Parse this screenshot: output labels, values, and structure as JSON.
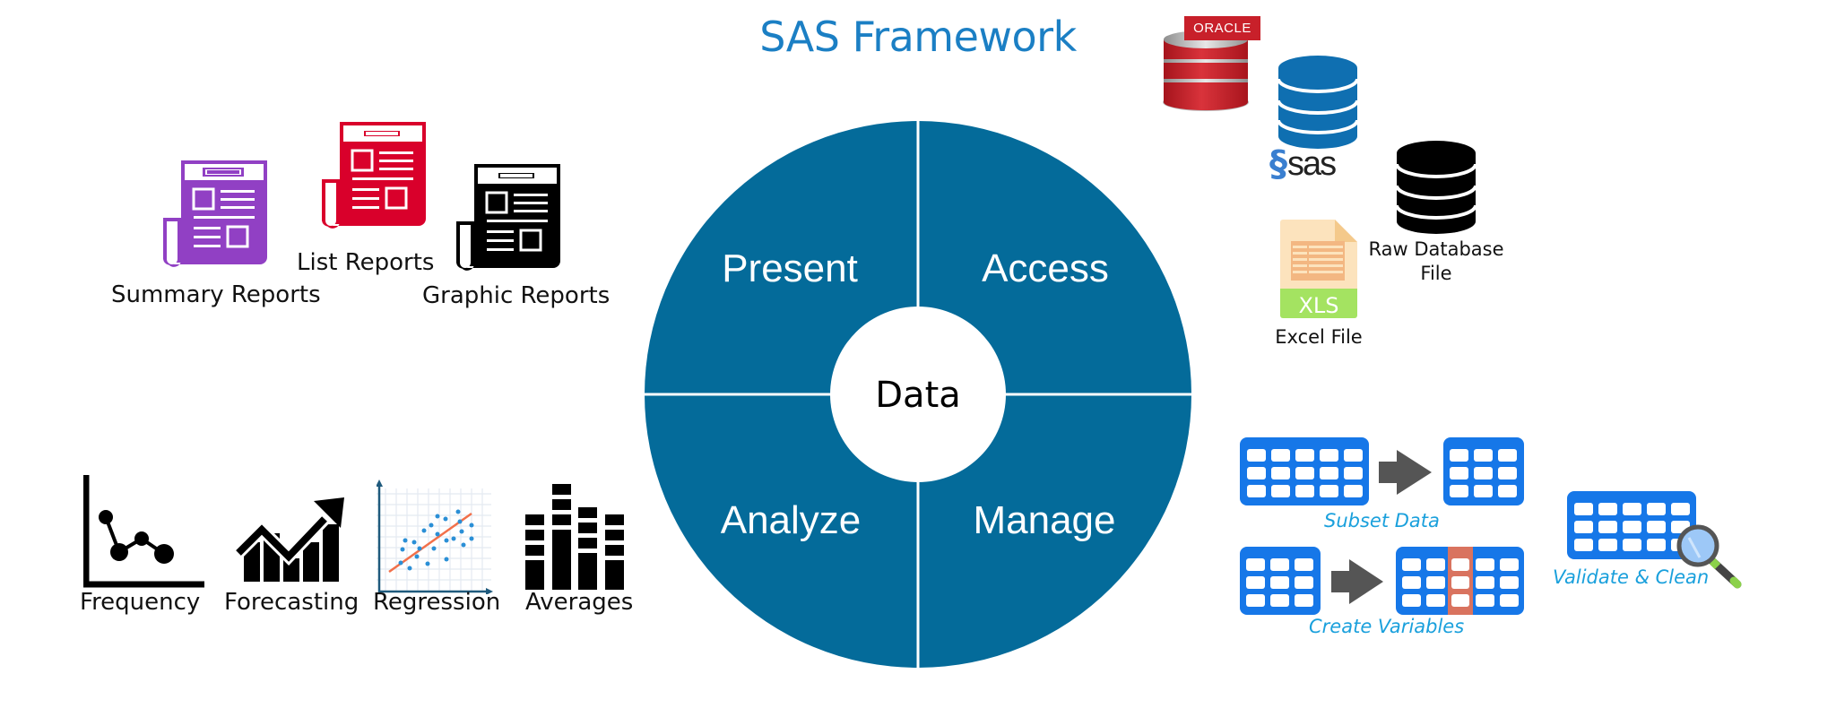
{
  "title": "SAS Framework",
  "wheel": {
    "center_label": "Data",
    "segments": [
      {
        "id": "present",
        "label": "Present"
      },
      {
        "id": "access",
        "label": "Access"
      },
      {
        "id": "analyze",
        "label": "Analyze"
      },
      {
        "id": "manage",
        "label": "Manage"
      }
    ],
    "color": "#046b9a"
  },
  "present": {
    "items": [
      {
        "label": "Summary  Reports",
        "icon": "report-icon",
        "color": "#9140c4"
      },
      {
        "label": "List Reports",
        "icon": "report-icon",
        "color": "#d9002b"
      },
      {
        "label": "Graphic Reports",
        "icon": "report-icon",
        "color": "#000000"
      }
    ]
  },
  "access": {
    "sources": [
      {
        "label": "ORACLE",
        "icon": "oracle-database-icon",
        "color": "#c8202a"
      },
      {
        "label": "sas",
        "icon": "sas-database-icon",
        "color": "#0f6fb1"
      },
      {
        "label": "Raw Database",
        "label2": "File",
        "icon": "database-icon",
        "color": "#000000"
      },
      {
        "label": "Excel File",
        "badge": "XLS",
        "icon": "excel-file-icon",
        "color": "#a4e361"
      }
    ]
  },
  "analyze": {
    "items": [
      {
        "label": "Frequency",
        "icon": "line-chart-icon"
      },
      {
        "label": "Forecasting",
        "icon": "trend-up-chart-icon"
      },
      {
        "label": "Regression",
        "icon": "scatter-regression-icon"
      },
      {
        "label": "Averages",
        "icon": "stacked-bar-icon"
      }
    ]
  },
  "manage": {
    "items": [
      {
        "label": "Subset Data",
        "icon": "table-subset-icon"
      },
      {
        "label": "Create Variables",
        "icon": "table-add-column-icon"
      },
      {
        "label": "Validate & Clean",
        "icon": "table-magnifier-icon"
      }
    ],
    "table_color": "#1677e8",
    "highlight_color": "#d9735f",
    "arrow_color": "#555555"
  }
}
